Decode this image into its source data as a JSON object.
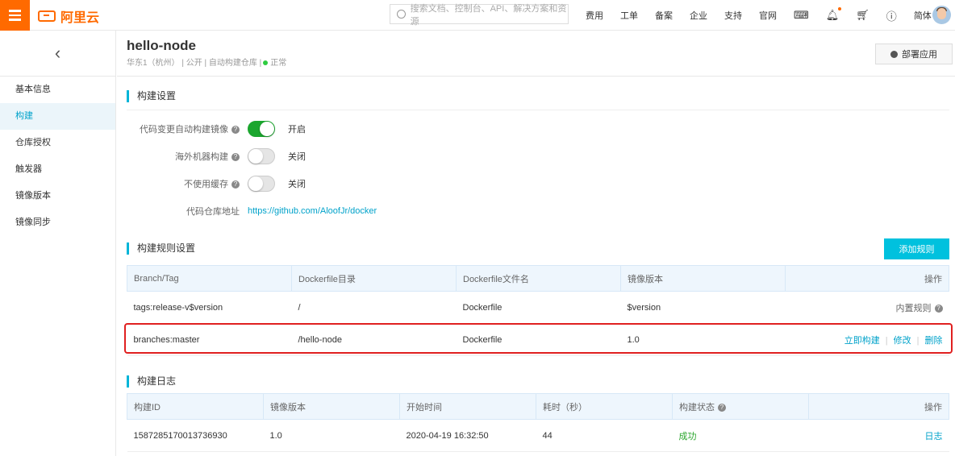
{
  "topbar": {
    "logo_text": "阿里云",
    "search_placeholder": "搜索文档、控制台、API、解决方案和资源",
    "nav": [
      "费用",
      "工单",
      "备案",
      "企业",
      "支持",
      "官网"
    ],
    "lang": "简体",
    "icons": [
      "terminal-icon",
      "bell-icon",
      "cart-icon",
      "help-icon"
    ]
  },
  "sidebar": {
    "back_glyph": "‹",
    "items": [
      {
        "label": "基本信息",
        "active": false
      },
      {
        "label": "构建",
        "active": true
      },
      {
        "label": "仓库授权",
        "active": false
      },
      {
        "label": "触发器",
        "active": false
      },
      {
        "label": "镜像版本",
        "active": false
      },
      {
        "label": "镜像同步",
        "active": false
      }
    ]
  },
  "header": {
    "title": "hello-node",
    "region": "华东1（杭州）",
    "visibility": "公开",
    "type": "自动构建仓库",
    "status": "正常",
    "deploy_button": "部署应用"
  },
  "build_settings": {
    "title": "构建设置",
    "rows": [
      {
        "label": "代码变更自动构建镜像",
        "on": true,
        "state": "开启"
      },
      {
        "label": "海外机器构建",
        "on": false,
        "state": "关闭"
      },
      {
        "label": "不使用缓存",
        "on": false,
        "state": "关闭"
      }
    ],
    "repo_label": "代码仓库地址",
    "repo_url": "https://github.com/AloofJr/docker"
  },
  "rules": {
    "title": "构建规则设置",
    "add_button": "添加规则",
    "columns": [
      "Branch/Tag",
      "Dockerfile目录",
      "Dockerfile文件名",
      "镜像版本",
      "操作"
    ],
    "rows": [
      {
        "branch": "tags:release-v$version",
        "dir": "/",
        "file": "Dockerfile",
        "version": "$version",
        "ops_text": "内置规则"
      },
      {
        "branch": "branches:master",
        "dir": "/hello-node",
        "file": "Dockerfile",
        "version": "1.0",
        "ops": [
          "立即构建",
          "修改",
          "删除"
        ]
      }
    ]
  },
  "logs": {
    "title": "构建日志",
    "columns": [
      "构建ID",
      "镜像版本",
      "开始时间",
      "耗时（秒）",
      "构建状态",
      "操作"
    ],
    "rows": [
      {
        "id": "1587285170013736930",
        "version": "1.0",
        "start": "2020-04-19 16:32:50",
        "duration": "44",
        "status": "成功",
        "op": "日志"
      }
    ]
  }
}
